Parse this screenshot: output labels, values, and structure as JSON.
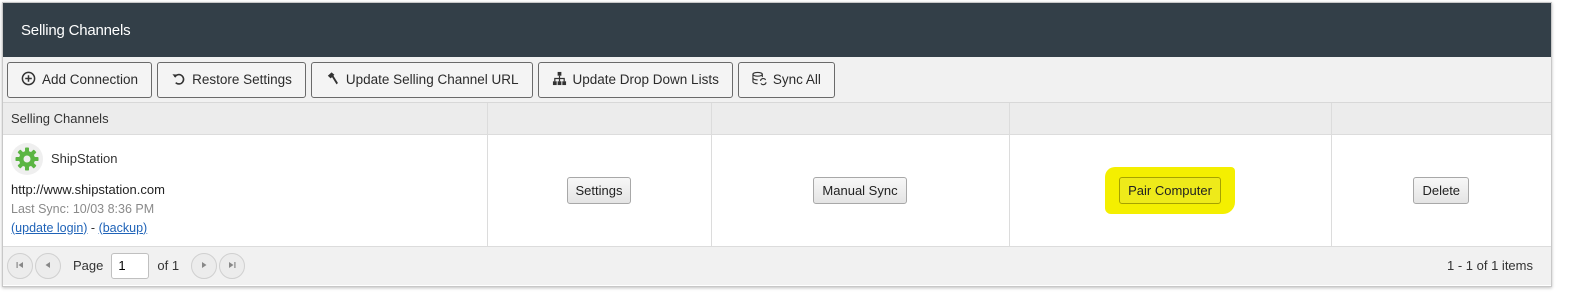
{
  "header": {
    "title": "Selling Channels"
  },
  "toolbar": {
    "buttons": [
      {
        "label": "Add Connection",
        "icon": "plus-circle-icon"
      },
      {
        "label": "Restore Settings",
        "icon": "undo-icon"
      },
      {
        "label": "Update Selling Channel URL",
        "icon": "hammer-icon"
      },
      {
        "label": "Update Drop Down Lists",
        "icon": "sitemap-icon"
      },
      {
        "label": "Sync All",
        "icon": "sync-database-icon"
      }
    ]
  },
  "grid": {
    "columns": [
      "Selling Channels",
      "",
      "",
      "",
      ""
    ],
    "rows": [
      {
        "channel_name": "ShipStation",
        "channel_icon": "gear-icon",
        "url": "http://www.shipstation.com",
        "last_sync": "Last Sync: 10/03 8:36 PM",
        "update_login_link": "(update login)",
        "separator": " - ",
        "backup_link": "(backup)",
        "settings_label": "Settings",
        "manual_sync_label": "Manual Sync",
        "pair_computer_label": "Pair Computer",
        "delete_label": "Delete"
      }
    ]
  },
  "pager": {
    "page_label": "Page",
    "page_value": "1",
    "of_label": "of 1",
    "info": "1 - 1 of 1 items"
  },
  "colors": {
    "header_bg": "#333f48",
    "gear_green": "#5bb543",
    "link_blue": "#1f63b8",
    "highlight_yellow": "#f4ef00"
  }
}
